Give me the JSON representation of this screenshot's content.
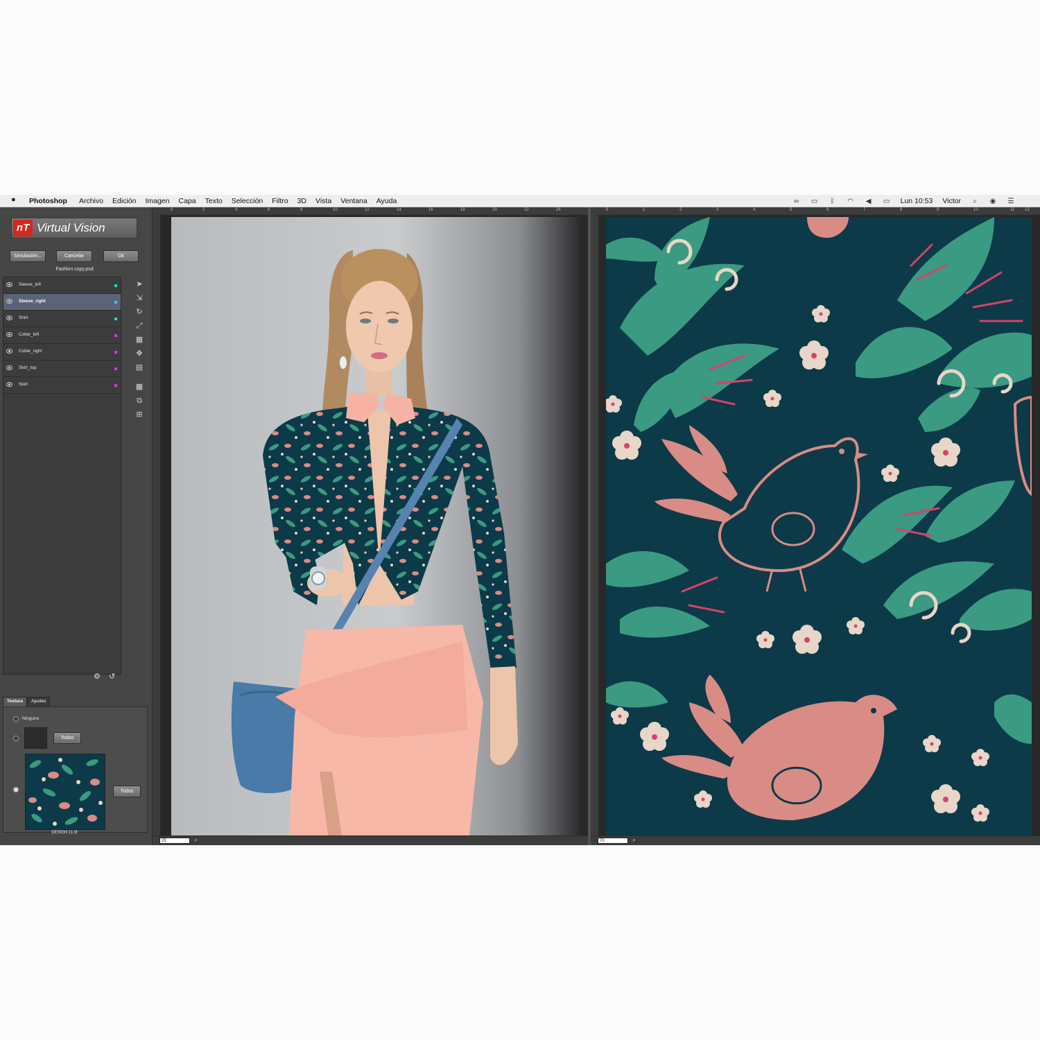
{
  "menubar": {
    "app_name": "Photoshop",
    "menus": [
      "Archivo",
      "Edición",
      "Imagen",
      "Capa",
      "Texto",
      "Selección",
      "Filtro",
      "3D",
      "Vista",
      "Ventana",
      "Ayuda"
    ],
    "clock": "Lun 10:53",
    "user": "Victor"
  },
  "plugin": {
    "logo_mark": "nT",
    "logo_text": "Virtual Vision",
    "buttons": {
      "simulate": "Simulación...",
      "cancel": "Cancelar",
      "ok": "Ok"
    },
    "file_name": "Fashion copy.psd",
    "layers": [
      {
        "name": "Sleeve_left",
        "color": "#2fd3c8",
        "selected": false
      },
      {
        "name": "Sleeve_right",
        "color": "#2fd3c8",
        "selected": true
      },
      {
        "name": "Shirt",
        "color": "#2fd3c8",
        "selected": false
      },
      {
        "name": "Collar_left",
        "color": "#d43fd0",
        "selected": false
      },
      {
        "name": "Collar_right",
        "color": "#d43fd0",
        "selected": false
      },
      {
        "name": "Skirt_top",
        "color": "#d43fd0",
        "selected": false
      },
      {
        "name": "Skirt",
        "color": "#d43fd0",
        "selected": false
      }
    ],
    "tabs": {
      "texture": "Textura",
      "adjust": "Ajustes"
    },
    "texture": {
      "none_label": "Ninguno",
      "all_label_1": "Todos",
      "all_label_2": "Todos",
      "design_name": "DESIGN 11.tif"
    }
  },
  "doc_left": {
    "zoom": "25",
    "ruler_ticks": [
      "0",
      "2",
      "4",
      "6",
      "8",
      "10",
      "12",
      "14",
      "16",
      "18",
      "20",
      "22",
      "24"
    ]
  },
  "doc_right": {
    "zoom": "70",
    "ruler_ticks": [
      "0",
      "1",
      "2",
      "3",
      "4",
      "5",
      "6",
      "7",
      "8",
      "9",
      "10",
      "11",
      "12"
    ]
  },
  "colors": {
    "fabric_bg": "#0c3a48",
    "leaf": "#3a9a82",
    "bird": "#d98c85",
    "flower": "#e8d6c9",
    "skirt": "#f7b8a8",
    "bag": "#4a7aa7"
  }
}
